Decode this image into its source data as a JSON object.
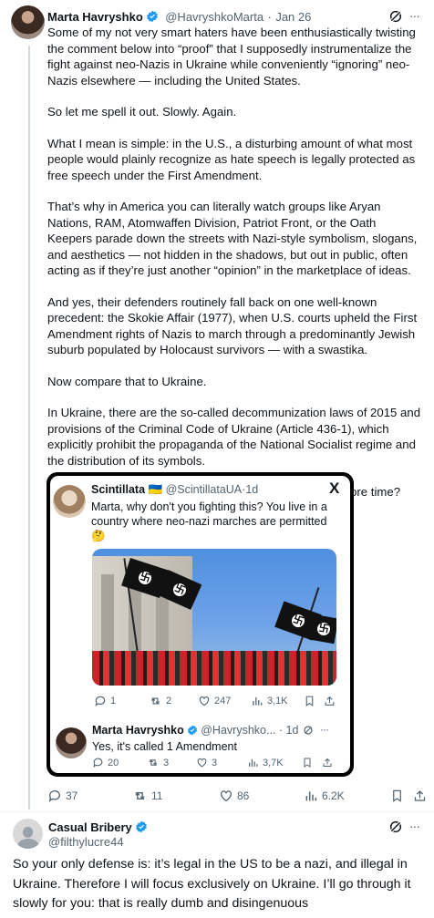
{
  "main_post": {
    "author_name": "Marta Havryshko",
    "handle": "@HavryshkoMarta",
    "separator": "·",
    "date": "Jan 26",
    "paragraphs": [
      "Some of my not very smart haters have been enthusiastically twisting the comment below into “proof” that I supposedly instrumentalize the fight against neo-Nazis in Ukraine while conveniently “ignoring” neo-Nazis elsewhere — including the United States.",
      "So let me spell it out. Slowly. Again.",
      "What I mean is simple: in the U.S., a disturbing amount of what most people would plainly recognize as hate speech is legally protected as free speech under the First Amendment.",
      "That’s why in America you can literally watch groups like Aryan Nations, RAM, Atomwaffen Division, Patriot Front, or the Oath Keepers parade down the streets with Nazi-style symbolism, slogans, and aesthetics — not hidden in the shadows, but out in public, often acting as if they’re just another “opinion” in the marketplace of ideas.",
      "And yes, their defenders routinely fall back on one well-known precedent: the Skokie Affair (1977), when U.S. courts upheld the First Amendment rights of Nazis to march through a predominantly Jewish suburb populated by Holocaust survivors — with a swastika.",
      "Now compare that to Ukraine.",
      "In Ukraine, there are the so-called decommunization laws of 2015 and provisions of the Criminal Code of Ukraine (Article 436-1), which explicitly prohibit the propaganda of the National Socialist regime and the distribution of its symbols.",
      "Is that clear now — or do we need to go through it one more time?"
    ],
    "stats": {
      "replies": "37",
      "reposts": "11",
      "likes": "86",
      "views": "6.2K"
    }
  },
  "quoted": {
    "first": {
      "author_name": "Scintillata",
      "flag_emoji": "🇺🇦",
      "handle": "@ScintillataUA",
      "separator": "·",
      "date": "1d",
      "text": "Marta, why don't you fighting this? You live in a country where neo-nazi marches are permitted",
      "emoji": "🤔",
      "x_logo": "X",
      "stats": {
        "replies": "1",
        "reposts": "2",
        "likes": "247",
        "views": "3,1K"
      }
    },
    "second": {
      "author_name": "Marta Havryshko",
      "handle": "@Havryshko...",
      "separator": "·",
      "date": "1d",
      "text": "Yes, it's called 1 Amendment",
      "stats": {
        "replies": "20",
        "reposts": "3",
        "likes": "3",
        "views": "3,7K"
      }
    }
  },
  "reply": {
    "author_name": "Casual Bribery",
    "handle": "@filthylucre44",
    "text": "So your only defense is: it’s legal in the US to be a nazi, and illegal in Ukraine. Therefore I will focus exclusively on Ukraine. I’ll go through it slowly for you: that is really dumb and disingenuous"
  },
  "more_glyph": "···",
  "colors": {
    "accent": "#1d9bf0",
    "muted": "#536471",
    "text": "#0f1419"
  }
}
